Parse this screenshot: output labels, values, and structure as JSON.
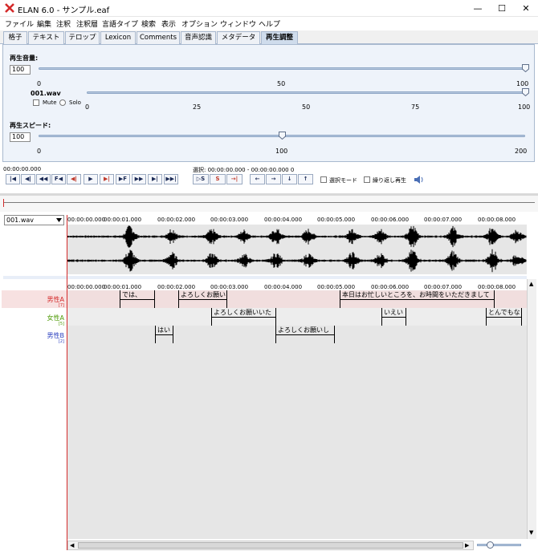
{
  "window": {
    "title": "ELAN 6.0 - サンプル.eaf",
    "minimize": "—",
    "maximize": "☐",
    "close": "✕",
    "accent_color": "#d42a2a"
  },
  "menu": [
    "ファイル",
    "編集",
    "注釈",
    "注釈層",
    "言語タイプ",
    "検索",
    "表示",
    "オプション",
    "ウィンドウ",
    "ヘルプ"
  ],
  "tabs": [
    "格子",
    "テキスト",
    "テロップ",
    "Lexicon",
    "Comments",
    "音声認識",
    "メタデータ",
    "再生調整"
  ],
  "active_tab": "再生調整",
  "playback": {
    "volume_label": "再生音量:",
    "volume_value": "100",
    "volume_ticks": [
      "0",
      "50",
      "100"
    ],
    "volume_level_percent": 100,
    "track_label": "001.wav",
    "track_ticks": [
      "0",
      "25",
      "50",
      "75",
      "100"
    ],
    "track_level_percent": 100,
    "mute_label": "Mute",
    "solo_label": "Solo",
    "speed_label": "再生スピード:",
    "speed_value": "100",
    "speed_ticks": [
      "0",
      "100",
      "200"
    ],
    "speed_value_numeric": 100,
    "speed_max": 200
  },
  "transport": {
    "current_time": "00:00:00.000",
    "selection": "選択: 00:00:00.000 - 00:00:00.000  0",
    "buttons_left": [
      "|◀",
      "◀|",
      "◀◀",
      "F◀",
      "◀|",
      "▶",
      "▶|",
      "▶F",
      "▶▶",
      "▶|",
      "▶▶|"
    ],
    "buttons_sel": [
      "▷S",
      "S",
      "→|"
    ],
    "buttons_nav": [
      "←",
      "→",
      "↓",
      "↑"
    ],
    "select_mode_label": "選択モード",
    "loop_label": "繰り返し再生",
    "sound_icon": "speaker-icon"
  },
  "media": {
    "selected": "001.wav",
    "ruler_ticks": [
      "00:00:00.000",
      "00:00:01.000",
      "00:00:02.000",
      "00:00:03.000",
      "00:00:04.000",
      "00:00:05.000",
      "00:00:06.000",
      "00:00:07.000",
      "00:00:08.000"
    ]
  },
  "tiers": [
    {
      "name": "男性A",
      "sub": "[7]",
      "color": "#d42a2a"
    },
    {
      "name": "女性A",
      "sub": "[5]",
      "color": "#4e9a06"
    },
    {
      "name": "男性B",
      "sub": "[2]",
      "color": "#2a3fbf"
    }
  ],
  "annotations": {
    "male_a": [
      "では、",
      "よろしくお願い",
      "本日はお忙しいところを、お時間をいただきまして"
    ],
    "female_a": [
      "よろしくお願いいた",
      "いえい",
      "とんでもな"
    ],
    "male_b": [
      "はい",
      "よろしくお願いし"
    ]
  }
}
